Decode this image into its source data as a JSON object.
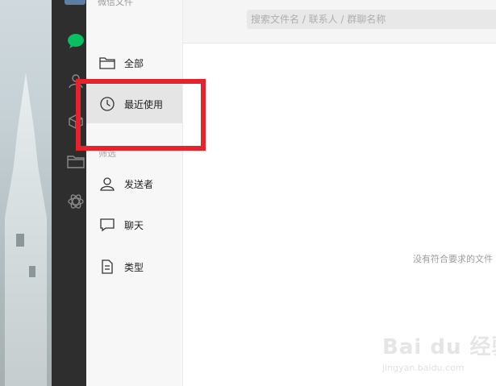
{
  "window": {
    "title": "微信文件"
  },
  "search": {
    "placeholder": "搜索文件名 / 联系人 / 群聊名称"
  },
  "sidebar": {
    "items": [
      {
        "label": "全部",
        "icon": "folder-icon"
      },
      {
        "label": "最近使用",
        "icon": "clock-icon",
        "active": true
      },
      {
        "label": "发送者",
        "icon": "person-icon"
      },
      {
        "label": "聊天",
        "icon": "chat-bubble-icon"
      },
      {
        "label": "类型",
        "icon": "document-icon"
      }
    ],
    "section_label": "筛选"
  },
  "rail": {
    "icons": [
      "chat-icon",
      "contacts-icon",
      "cube-icon",
      "folder-icon",
      "mini-program-icon"
    ],
    "accent": "#07c160"
  },
  "main": {
    "empty_text": "没有符合要求的文件"
  },
  "watermark": {
    "brand": "Bai du 经验",
    "url": "jingyan.baidu.com"
  },
  "colors": {
    "highlight": "#e8222b",
    "rail_bg": "#2e2e2e",
    "active_item_bg": "#e5e5e5"
  }
}
